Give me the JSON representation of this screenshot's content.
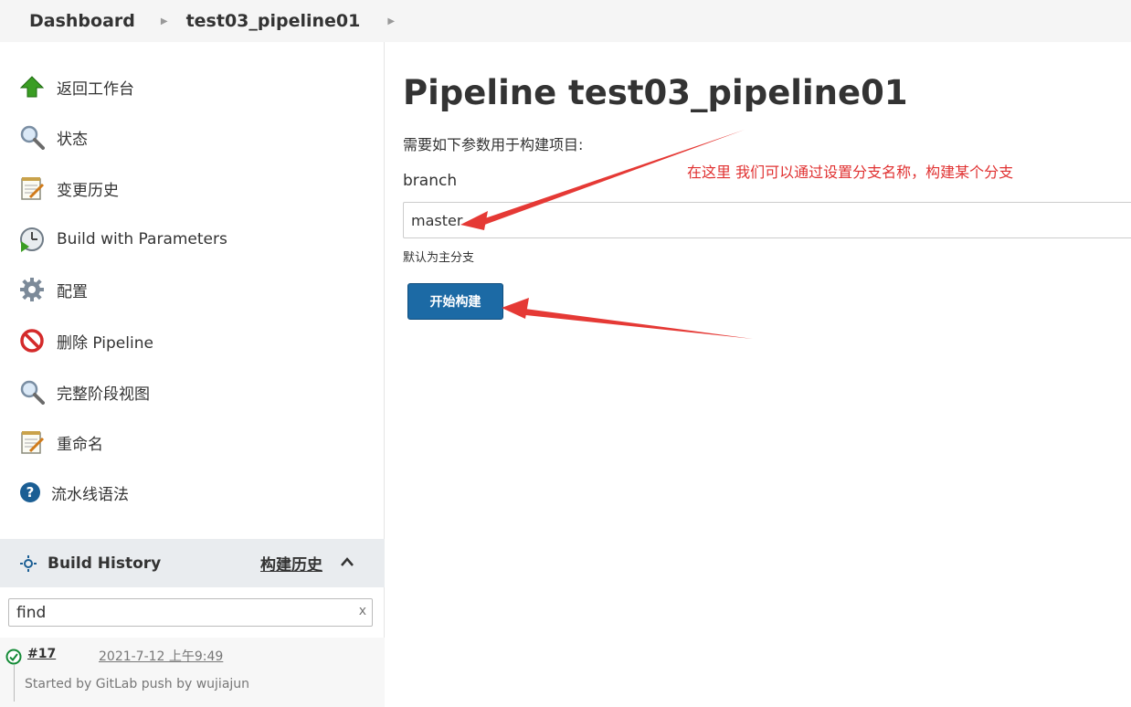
{
  "breadcrumb": {
    "items": [
      "Dashboard",
      "test03_pipeline01"
    ]
  },
  "sidebar": {
    "items": [
      {
        "label": "返回工作台",
        "icon": "up-arrow-icon"
      },
      {
        "label": "状态",
        "icon": "magnifier-icon"
      },
      {
        "label": "变更历史",
        "icon": "notepad-icon"
      },
      {
        "label": "Build with Parameters",
        "icon": "clock-play-icon"
      },
      {
        "label": "配置",
        "icon": "gear-icon"
      },
      {
        "label": "删除 Pipeline",
        "icon": "no-entry-icon"
      },
      {
        "label": "完整阶段视图",
        "icon": "magnifier-icon"
      },
      {
        "label": "重命名",
        "icon": "notepad-icon"
      },
      {
        "label": "流水线语法",
        "icon": "help-icon"
      }
    ]
  },
  "build_history": {
    "title": "Build History",
    "trend_label": "构建历史",
    "search": {
      "value": "find",
      "clear": "x"
    },
    "builds": [
      {
        "number": "#17",
        "date": "2021-7-12 上午9:49",
        "cause": "Started by GitLab push by wujiajun"
      }
    ]
  },
  "main": {
    "title": "Pipeline test03_pipeline01",
    "description": "需要如下参数用于构建项目:",
    "parameter": {
      "name": "branch",
      "value": "master",
      "help": "默认为主分支"
    },
    "build_button": "开始构建",
    "annotation": "在这里 我们可以通过设置分支名称，构建某个分支"
  },
  "colors": {
    "accent": "#1c6aa5",
    "annotation": "#e03131",
    "success": "#138a36"
  }
}
